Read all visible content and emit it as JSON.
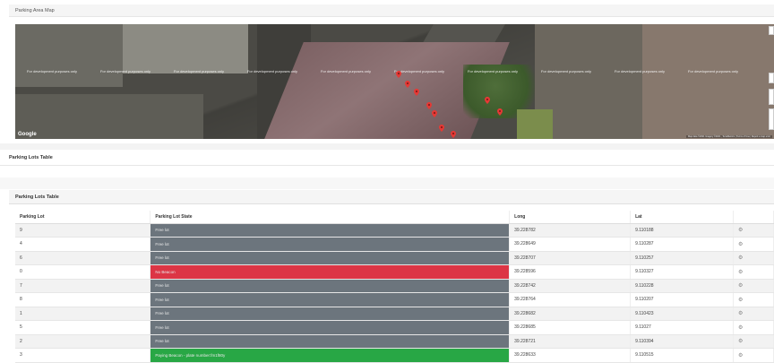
{
  "map_panel": {
    "title": "Parking Area Map",
    "watermark": "For development purposes only",
    "google_label": "Google",
    "attribution": "Map data ©2021 Imagery ©2021 , TerraMetrics | Terms of Use | Report a map error"
  },
  "section": {
    "title": "Parking Lots Table"
  },
  "table_panel": {
    "title": "Parking Lots Table",
    "columns": [
      "Parking Lot",
      "Parking Lot State",
      "Long",
      "Lat",
      ""
    ],
    "rows": [
      {
        "lot": "9",
        "state": "Free lot",
        "state_kind": "free",
        "long": "39.228782",
        "lat": "9.110188",
        "action_icon": "gear-icon"
      },
      {
        "lot": "4",
        "state": "Free lot",
        "state_kind": "free",
        "long": "39.228649",
        "lat": "9.110287",
        "action_icon": "gear-icon"
      },
      {
        "lot": "6",
        "state": "Free lot",
        "state_kind": "free",
        "long": "39.228707",
        "lat": "9.110257",
        "action_icon": "gear-icon"
      },
      {
        "lot": "0",
        "state": "No Beacon",
        "state_kind": "nobeacon",
        "long": "39.228596",
        "lat": "9.110327",
        "action_icon": "gear-icon"
      },
      {
        "lot": "7",
        "state": "Free lot",
        "state_kind": "free",
        "long": "39.228742",
        "lat": "9.110228",
        "action_icon": "gear-icon"
      },
      {
        "lot": "8",
        "state": "Free lot",
        "state_kind": "free",
        "long": "39.228764",
        "lat": "9.110207",
        "action_icon": "gear-icon"
      },
      {
        "lot": "1",
        "state": "Free lot",
        "state_kind": "free",
        "long": "39.228682",
        "lat": "9.110423",
        "action_icon": "gear-icon"
      },
      {
        "lot": "5",
        "state": "Free lot",
        "state_kind": "free",
        "long": "39.228685",
        "lat": "9.11027",
        "action_icon": "gear-icon"
      },
      {
        "lot": "2",
        "state": "Free lot",
        "state_kind": "free",
        "long": "39.228721",
        "lat": "9.110394",
        "action_icon": "gear-icon"
      },
      {
        "lot": "3",
        "state": "Paying Beacon - plate number:fm1f80y",
        "state_kind": "paying",
        "long": "39.228633",
        "lat": "9.110515",
        "action_icon": "gear-icon"
      }
    ]
  },
  "colors": {
    "free": "#6c757d",
    "nobeacon": "#dc3545",
    "paying": "#28a745",
    "pin": "#e53935"
  }
}
